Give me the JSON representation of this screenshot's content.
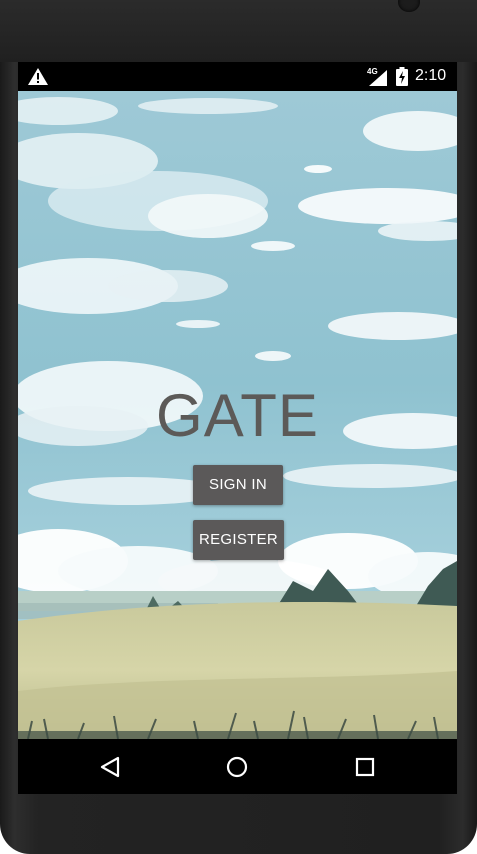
{
  "status_bar": {
    "network": "4G",
    "time": "2:10",
    "icons": [
      "warning-icon",
      "signal-icon",
      "battery-charging-icon"
    ]
  },
  "app": {
    "title": "GATE",
    "sign_in_label": "SIGN IN",
    "register_label": "REGISTER",
    "button_color": "#5b5959"
  },
  "nav_bar": {
    "icons": [
      "back-icon",
      "home-icon",
      "recents-icon"
    ]
  }
}
